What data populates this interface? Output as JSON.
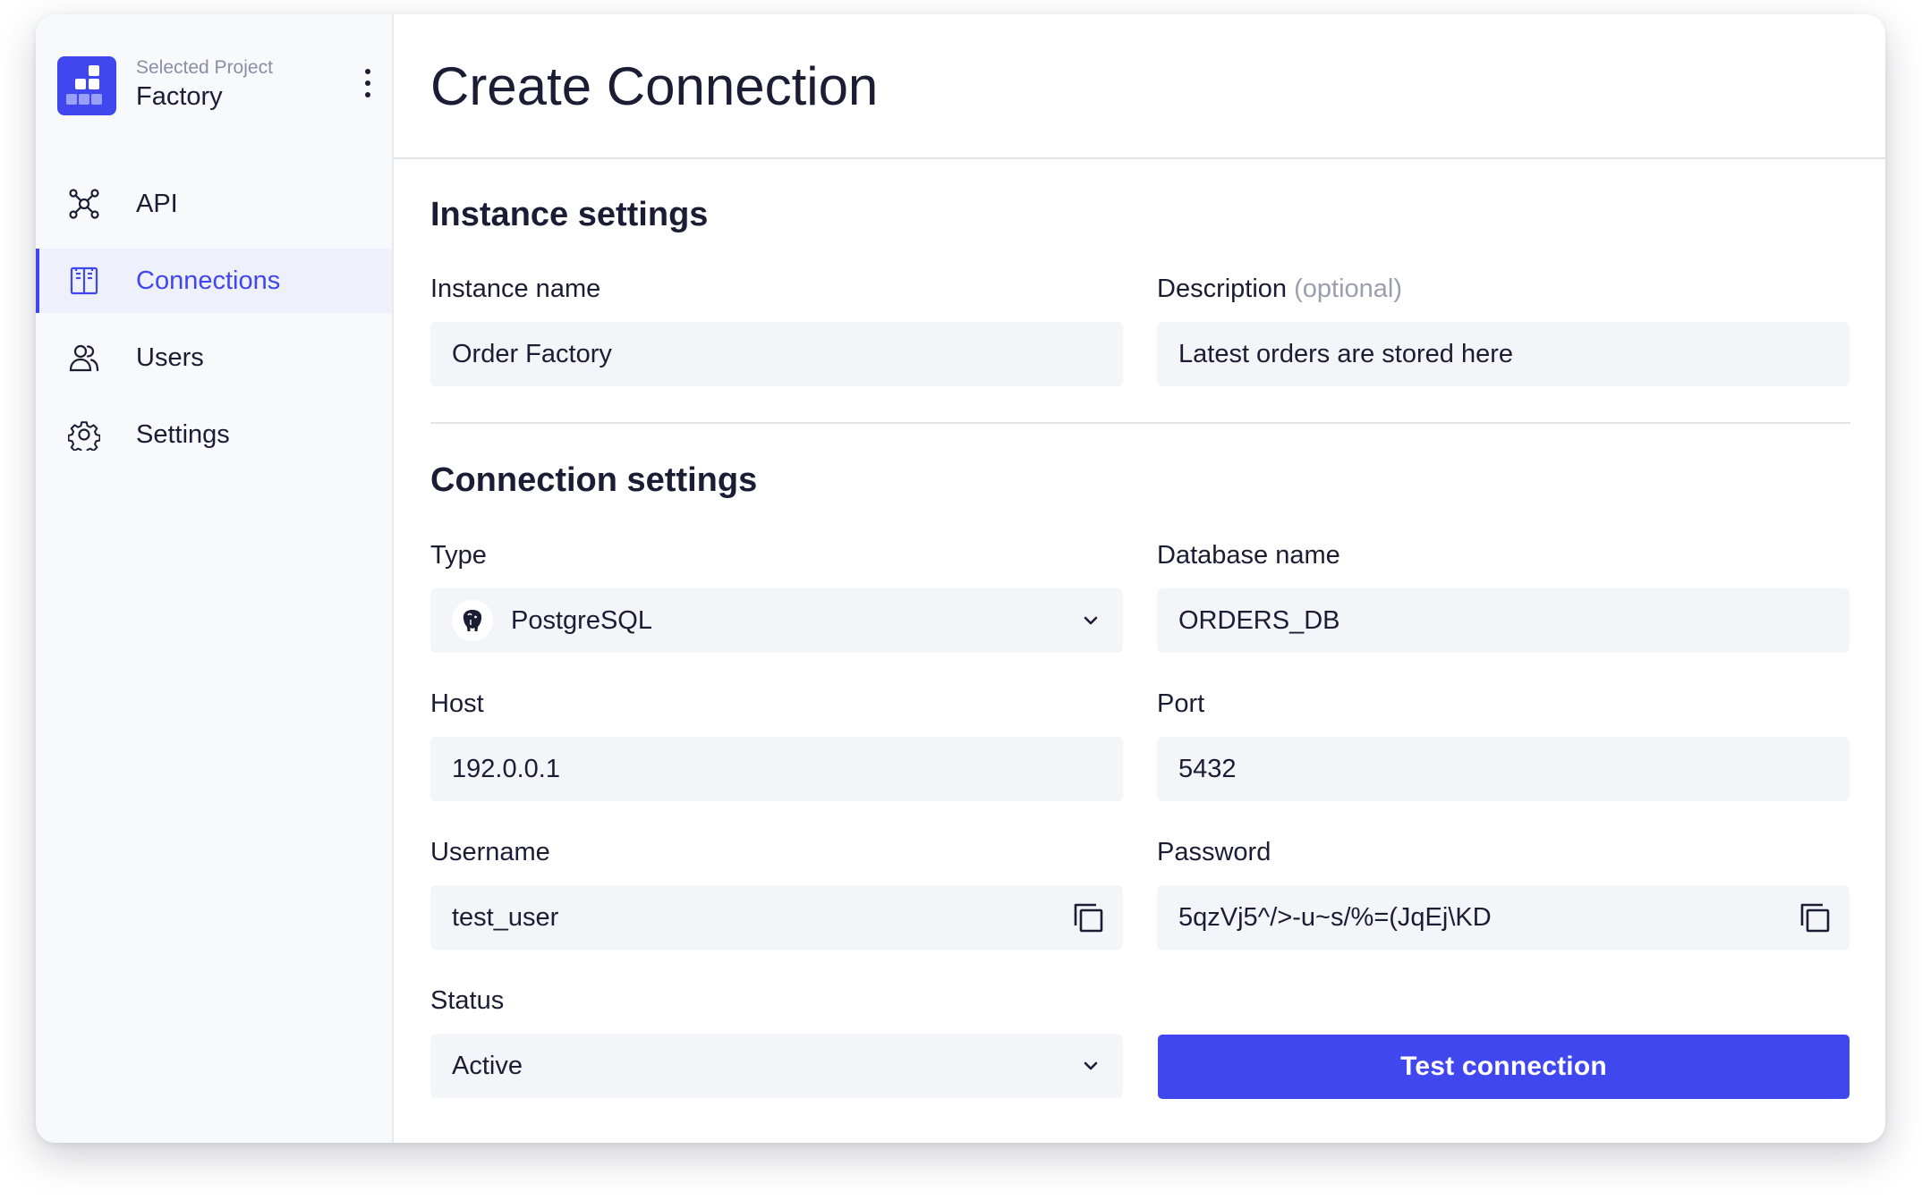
{
  "project": {
    "caption": "Selected Project",
    "name": "Factory"
  },
  "nav": {
    "items": [
      {
        "label": "API",
        "icon": "api-nodes-icon"
      },
      {
        "label": "Connections",
        "icon": "connections-book-icon",
        "active": true
      },
      {
        "label": "Users",
        "icon": "users-icon"
      },
      {
        "label": "Settings",
        "icon": "gear-icon"
      }
    ]
  },
  "page": {
    "title": "Create Connection"
  },
  "instance": {
    "heading": "Instance settings",
    "name_label": "Instance name",
    "name_value": "Order Factory",
    "description_label": "Description",
    "description_optional": "(optional)",
    "description_value": "Latest orders are stored here"
  },
  "connection": {
    "heading": "Connection settings",
    "type_label": "Type",
    "type_value": "PostgreSQL",
    "database_label": "Database name",
    "database_value": "ORDERS_DB",
    "host_label": "Host",
    "host_value": "192.0.0.1",
    "port_label": "Port",
    "port_value": "5432",
    "username_label": "Username",
    "username_value": "test_user",
    "password_label": "Password",
    "password_value": "5qzVj5^/>-u~s/%=(JqEj\\KD",
    "status_label": "Status",
    "status_value": "Active",
    "test_button": "Test connection"
  },
  "colors": {
    "accent": "#4047ee",
    "sidebar_bg": "#f8f9fd",
    "input_bg": "#f4f5f8",
    "text": "#1a1d33",
    "muted": "#8a8fa3"
  }
}
